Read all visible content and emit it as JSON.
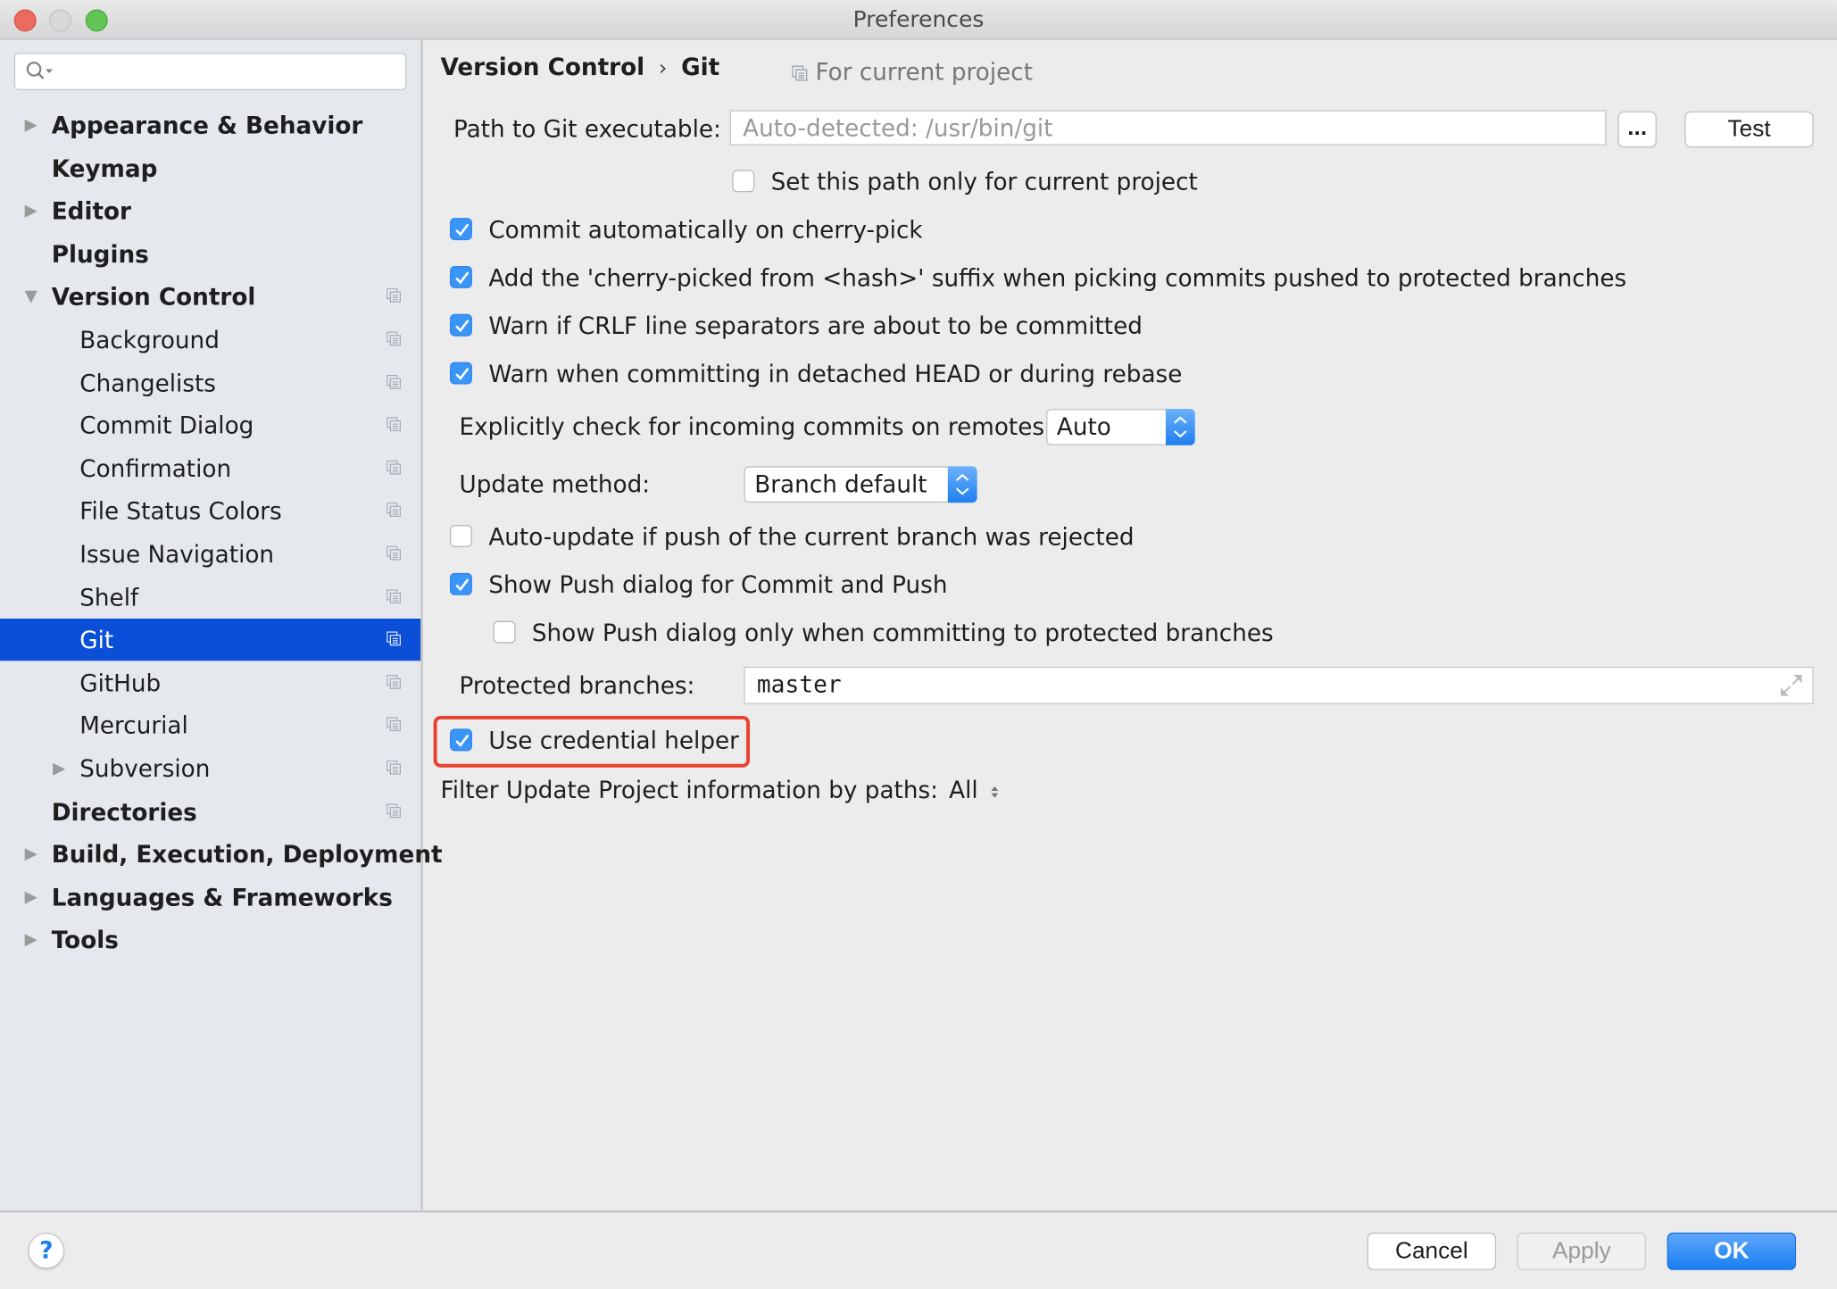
{
  "window": {
    "title": "Preferences",
    "traffic_lights": [
      {
        "name": "close",
        "color": "#ed6a5e"
      },
      {
        "name": "minimize",
        "color": "#d8d8d8"
      },
      {
        "name": "zoom",
        "color": "#61c454"
      }
    ]
  },
  "sidebar": {
    "search": {
      "value": "",
      "placeholder": "",
      "icon": "search-icon"
    },
    "items": [
      {
        "label": "Appearance & Behavior",
        "level": 0,
        "bold": true,
        "arrow": "collapsed",
        "project_icon": false,
        "selected": false
      },
      {
        "label": "Keymap",
        "level": 0,
        "bold": true,
        "arrow": "none",
        "project_icon": false,
        "selected": false
      },
      {
        "label": "Editor",
        "level": 0,
        "bold": true,
        "arrow": "collapsed",
        "project_icon": false,
        "selected": false
      },
      {
        "label": "Plugins",
        "level": 0,
        "bold": true,
        "arrow": "none",
        "project_icon": false,
        "selected": false
      },
      {
        "label": "Version Control",
        "level": 0,
        "bold": true,
        "arrow": "expanded",
        "project_icon": true,
        "selected": false
      },
      {
        "label": "Background",
        "level": 1,
        "bold": false,
        "arrow": "none",
        "project_icon": true,
        "selected": false
      },
      {
        "label": "Changelists",
        "level": 1,
        "bold": false,
        "arrow": "none",
        "project_icon": true,
        "selected": false
      },
      {
        "label": "Commit Dialog",
        "level": 1,
        "bold": false,
        "arrow": "none",
        "project_icon": true,
        "selected": false
      },
      {
        "label": "Confirmation",
        "level": 1,
        "bold": false,
        "arrow": "none",
        "project_icon": true,
        "selected": false
      },
      {
        "label": "File Status Colors",
        "level": 1,
        "bold": false,
        "arrow": "none",
        "project_icon": true,
        "selected": false
      },
      {
        "label": "Issue Navigation",
        "level": 1,
        "bold": false,
        "arrow": "none",
        "project_icon": true,
        "selected": false
      },
      {
        "label": "Shelf",
        "level": 1,
        "bold": false,
        "arrow": "none",
        "project_icon": true,
        "selected": false
      },
      {
        "label": "Git",
        "level": 1,
        "bold": false,
        "arrow": "none",
        "project_icon": true,
        "selected": true
      },
      {
        "label": "GitHub",
        "level": 1,
        "bold": false,
        "arrow": "none",
        "project_icon": true,
        "selected": false
      },
      {
        "label": "Mercurial",
        "level": 1,
        "bold": false,
        "arrow": "none",
        "project_icon": true,
        "selected": false
      },
      {
        "label": "Subversion",
        "level": 1,
        "bold": false,
        "arrow": "collapsed",
        "project_icon": true,
        "selected": false
      },
      {
        "label": "Directories",
        "level": 0,
        "bold": true,
        "arrow": "none",
        "project_icon": true,
        "selected": false
      },
      {
        "label": "Build, Execution, Deployment",
        "level": 0,
        "bold": true,
        "arrow": "collapsed",
        "project_icon": false,
        "selected": false
      },
      {
        "label": "Languages & Frameworks",
        "level": 0,
        "bold": true,
        "arrow": "collapsed",
        "project_icon": false,
        "selected": false
      },
      {
        "label": "Tools",
        "level": 0,
        "bold": true,
        "arrow": "collapsed",
        "project_icon": false,
        "selected": false
      }
    ]
  },
  "main": {
    "breadcrumb": {
      "parent": "Version Control",
      "separator": "›",
      "current": "Git"
    },
    "for_current_project": "For current project",
    "git_path": {
      "label": "Path to Git executable:",
      "value": "",
      "placeholder": "Auto-detected: /usr/bin/git",
      "browse_label": "...",
      "test_label": "Test"
    },
    "set_path_only": {
      "label": "Set this path only for current project",
      "checked": false
    },
    "checkboxes": [
      {
        "label": "Commit automatically on cherry-pick",
        "checked": true
      },
      {
        "label": "Add the 'cherry-picked from <hash>' suffix when picking commits pushed to protected branches",
        "checked": true
      },
      {
        "label": "Warn if CRLF line separators are about to be committed",
        "checked": true
      },
      {
        "label": "Warn when committing in detached HEAD or during rebase",
        "checked": true
      }
    ],
    "incoming_commits": {
      "label": "Explicitly check for incoming commits on remotes:",
      "value": "Auto"
    },
    "update_method": {
      "label": "Update method:",
      "value": "Branch default"
    },
    "auto_update": {
      "label": "Auto-update if push of the current branch was rejected",
      "checked": false
    },
    "show_push": {
      "label": "Show Push dialog for Commit and Push",
      "checked": true
    },
    "show_push_protected": {
      "label": "Show Push dialog only when committing to protected branches",
      "checked": false
    },
    "protected_branches": {
      "label": "Protected branches:",
      "value": "master"
    },
    "credential_helper": {
      "label": "Use credential helper",
      "checked": true,
      "highlight_color": "#e8412e"
    },
    "filter_update": {
      "label": "Filter Update Project information by paths:",
      "value": "All"
    }
  },
  "footer": {
    "help_label": "?",
    "cancel_label": "Cancel",
    "apply_label": "Apply",
    "ok_label": "OK"
  },
  "colors": {
    "accent": "#1a7ff2",
    "selection": "#0b4fd8",
    "checkbox": "#3b95f7"
  }
}
